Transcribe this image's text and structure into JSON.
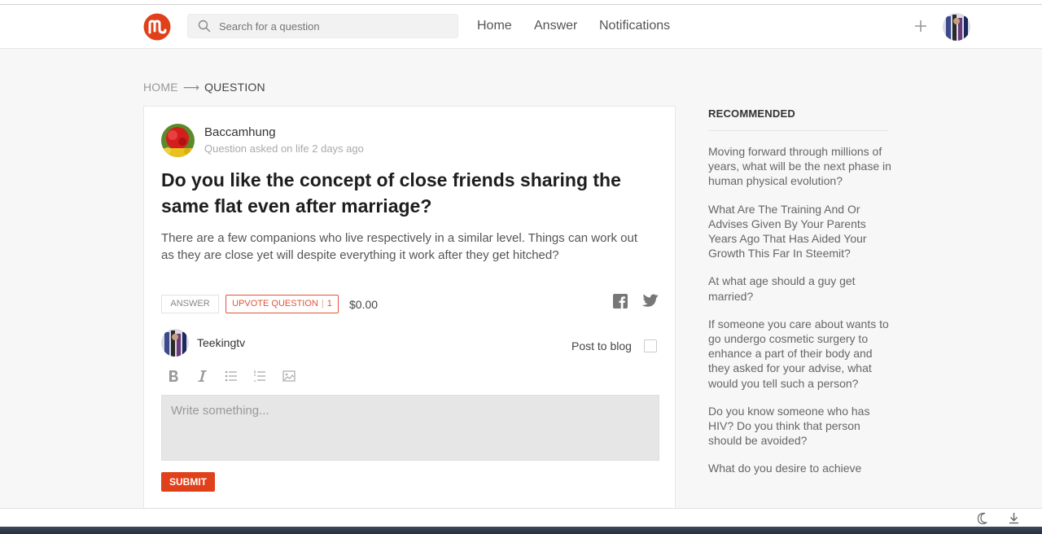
{
  "nav": {
    "search_placeholder": "Search for a question",
    "links": [
      "Home",
      "Answer",
      "Notifications"
    ]
  },
  "breadcrumb": {
    "home": "HOME",
    "current": "QUESTION"
  },
  "question": {
    "author": "Baccamhung",
    "meta": "Question asked on life 2 days ago",
    "title": "Do you like the concept of close friends sharing the same flat even after marriage?",
    "body": "There are a few companions who live respectively in a similar level. Things can work out as they are close yet will despite everything it work after they get hitched?",
    "answer_label": "ANSWER",
    "upvote_label": "UPVOTE QUESTION",
    "upvote_count": "1",
    "payout": "$0.00"
  },
  "reply": {
    "user": "Teekingtv",
    "post_to_blog": "Post to blog",
    "placeholder": "Write something...",
    "submit": "SUBMIT"
  },
  "sidebar": {
    "title": "RECOMMENDED",
    "items": [
      "Moving forward through millions of years, what will be the next phase in human physical evolution?",
      "What Are The Training And Or Advises Given By Your Parents Years Ago That Has Aided Your Growth This Far In Steemit?",
      "At what age should a guy get married?",
      "If someone you care about wants to go undergo cosmetic surgery to enhance a part of their body and they asked for your advise, what would you tell such a person?",
      "Do you know someone who has HIV? Do you think that person should be avoided?",
      "What do you desire to achieve"
    ]
  },
  "colors": {
    "brand": "#e0411b",
    "upvote": "#e0553a"
  }
}
